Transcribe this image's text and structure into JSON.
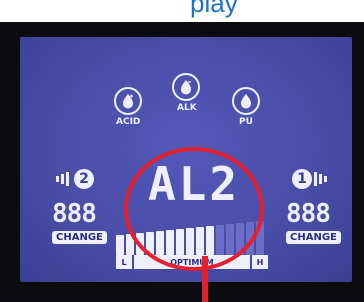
{
  "header": {
    "partial_text": "play"
  },
  "colors": {
    "accent_red": "#e5202e",
    "lcd_blue": "#4a4ea8",
    "lcd_segment": "#eef0ff"
  },
  "modes": [
    {
      "label": "ACID",
      "icon": "water-drop-plus-icon"
    },
    {
      "label": "ALK",
      "icon": "water-drop-minus-icon"
    },
    {
      "label": "PU",
      "icon": "water-drop-icon"
    }
  ],
  "display": {
    "code": "AL2"
  },
  "left_panel": {
    "number": "2",
    "digits": "888",
    "change_label": "CHANGE"
  },
  "right_panel": {
    "number": "1",
    "digits": "888",
    "change_label": "CHANGE"
  },
  "scale": {
    "low_label": "L",
    "mid_label": "OPTIMUM",
    "high_label": "H",
    "level_fraction": 0.67
  }
}
